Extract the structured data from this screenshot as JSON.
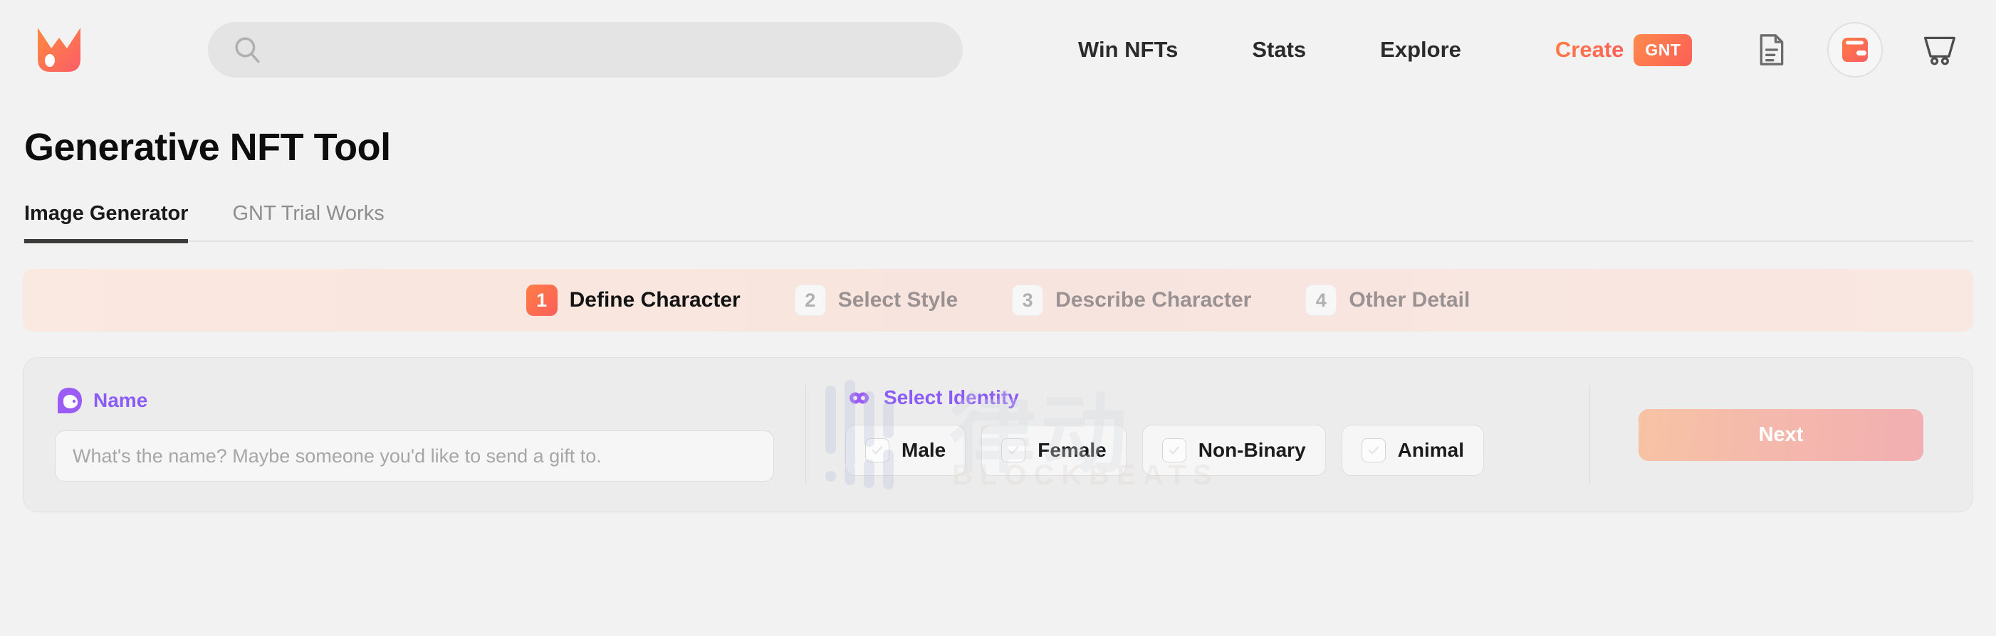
{
  "header": {
    "logo_name": "brand-logo",
    "search": {
      "value": "",
      "placeholder": ""
    },
    "nav_links": [
      {
        "label": "Win NFTs"
      },
      {
        "label": "Stats"
      },
      {
        "label": "Explore"
      }
    ],
    "create": {
      "label": "Create",
      "badge": "GNT"
    },
    "icons": [
      {
        "name": "document-icon"
      },
      {
        "name": "wallet-icon"
      },
      {
        "name": "cart-icon"
      }
    ]
  },
  "page": {
    "title": "Generative NFT Tool"
  },
  "tabs": [
    {
      "label": "Image Generator",
      "active": true
    },
    {
      "label": "GNT Trial Works",
      "active": false
    }
  ],
  "stepper": {
    "steps": [
      {
        "num": "1",
        "label": "Define Character",
        "active": true
      },
      {
        "num": "2",
        "label": "Select Style",
        "active": false
      },
      {
        "num": "3",
        "label": "Describe Character",
        "active": false
      },
      {
        "num": "4",
        "label": "Other Detail",
        "active": false
      }
    ],
    "active_color": "#fa5f5a",
    "background": "#f8e4de"
  },
  "form": {
    "name_field": {
      "label": "Name",
      "icon": "avatar-icon",
      "value": "",
      "placeholder": "What's the name? Maybe someone you'd like to send a gift to."
    },
    "identity_field": {
      "label": "Select Identity",
      "icon": "infinity-icon",
      "options": [
        {
          "label": "Male",
          "checked": false
        },
        {
          "label": "Female",
          "checked": false
        },
        {
          "label": "Non-Binary",
          "checked": false
        },
        {
          "label": "Animal",
          "checked": false
        }
      ]
    },
    "next_button": {
      "label": "Next",
      "disabled": true
    },
    "label_color": "#8b5cf6"
  },
  "watermark": {
    "cn_text": "律动",
    "en_text": "BLOCKBEATS"
  }
}
